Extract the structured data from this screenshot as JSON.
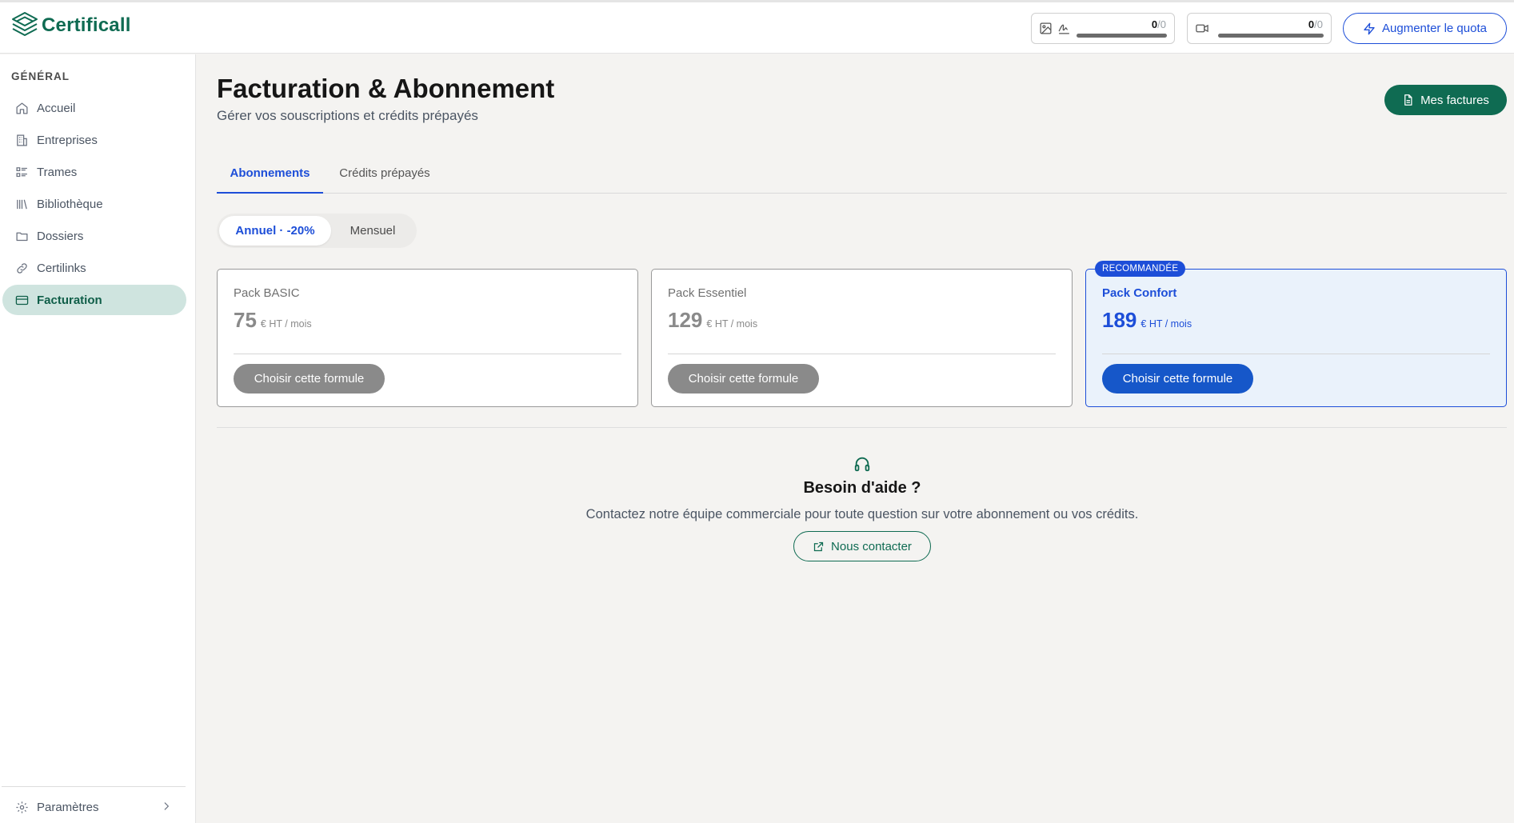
{
  "app": {
    "name": "Certificall"
  },
  "header": {
    "quota_images": {
      "used": "0",
      "max": "/0"
    },
    "quota_video": {
      "used": "0",
      "max": "/0"
    },
    "increase_quota_label": "Augmenter le quota"
  },
  "sidebar": {
    "section_label": "GÉNÉRAL",
    "items": [
      {
        "label": "Accueil",
        "icon": "home-icon"
      },
      {
        "label": "Entreprises",
        "icon": "building-icon"
      },
      {
        "label": "Trames",
        "icon": "list-icon"
      },
      {
        "label": "Bibliothèque",
        "icon": "library-icon"
      },
      {
        "label": "Dossiers",
        "icon": "folder-icon"
      },
      {
        "label": "Certilinks",
        "icon": "link-icon"
      },
      {
        "label": "Facturation",
        "icon": "credit-card-icon",
        "active": true
      }
    ],
    "settings_label": "Paramètres"
  },
  "main": {
    "title": "Facturation & Abonnement",
    "subtitle": "Gérer vos souscriptions et crédits prépayés",
    "invoices_label": "Mes factures",
    "tabs": [
      {
        "label": "Abonnements",
        "active": true
      },
      {
        "label": "Crédits prépayés",
        "active": false
      }
    ],
    "billing_toggle": [
      {
        "label": "Annuel · -20%",
        "active": true
      },
      {
        "label": "Mensuel",
        "active": false
      }
    ],
    "plans": [
      {
        "name": "Pack BASIC",
        "price": "75",
        "unit": "€ HT / mois",
        "button": "Choisir cette formule"
      },
      {
        "name": "Pack Essentiel",
        "price": "129",
        "unit": "€ HT / mois",
        "button": "Choisir cette formule"
      },
      {
        "name": "Pack Confort",
        "price": "189",
        "unit": "€ HT / mois",
        "button": "Choisir cette formule",
        "badge": "RECOMMANDÉE"
      }
    ],
    "help": {
      "title": "Besoin d'aide ?",
      "text": "Contactez notre équipe commerciale pour toute question sur votre abonnement ou vos crédits.",
      "contact_label": "Nous contacter"
    }
  },
  "colors": {
    "brand_green": "#0f6b52",
    "accent_blue": "#1d4ed8",
    "active_nav_bg": "#cfe4df",
    "recommended_bg": "#eaf2fb"
  }
}
